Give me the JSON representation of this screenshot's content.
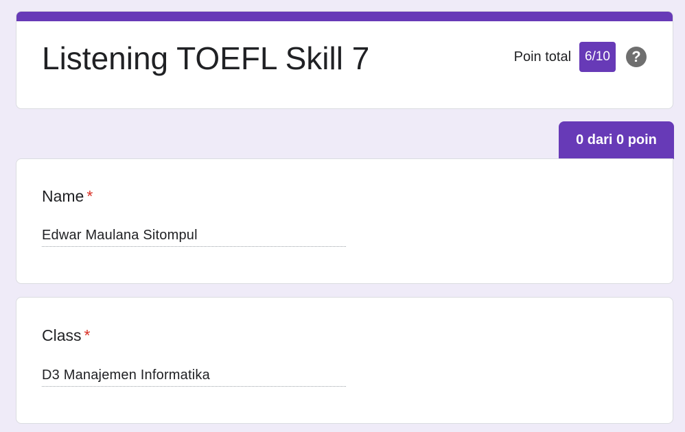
{
  "header": {
    "title": "Listening TOEFL Skill 7",
    "score_label": "Poin total",
    "score_value": "6/10",
    "help_icon": "help-circle-icon"
  },
  "points_tab": {
    "label": "0 dari 0 poin"
  },
  "questions": [
    {
      "title": "Name",
      "required_mark": "*",
      "answer": "Edwar Maulana Sitompul"
    },
    {
      "title": "Class",
      "required_mark": "*",
      "answer": "D3 Manajemen Informatika"
    }
  ],
  "colors": {
    "accent": "#673ab7",
    "background": "#efebf8",
    "required": "#d93025"
  }
}
